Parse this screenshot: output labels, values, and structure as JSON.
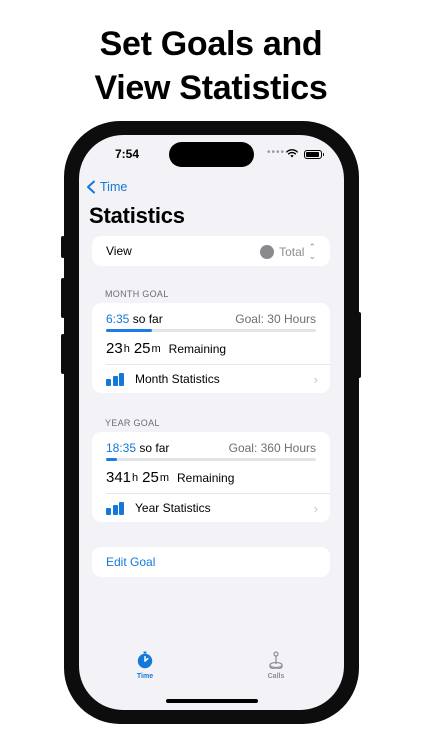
{
  "headline": {
    "line1": "Set Goals and",
    "line2": "View Statistics"
  },
  "status_bar": {
    "time": "7:54"
  },
  "nav": {
    "back_label": "Time",
    "title": "Statistics"
  },
  "view_row": {
    "label": "View",
    "value": "Total",
    "dot_color": "#8a8a8e"
  },
  "month_goal": {
    "section_label": "MONTH GOAL",
    "so_far_time": "6:35",
    "so_far_suffix": "so far",
    "goal_text": "Goal: 30 Hours",
    "progress_fraction": 0.22,
    "hours": "23",
    "hours_unit": "h",
    "minutes": "25",
    "minutes_unit": "m",
    "remaining_label": "Remaining",
    "stats_label": "Month Statistics"
  },
  "year_goal": {
    "section_label": "YEAR GOAL",
    "so_far_time": "18:35",
    "so_far_suffix": "so far",
    "goal_text": "Goal: 360 Hours",
    "progress_fraction": 0.05,
    "hours": "341",
    "hours_unit": "h",
    "minutes": "25",
    "minutes_unit": "m",
    "remaining_label": "Remaining",
    "stats_label": "Year Statistics"
  },
  "edit_goal_label": "Edit Goal",
  "tabs": [
    {
      "label": "Time",
      "icon": "stopwatch-icon",
      "selected": true
    },
    {
      "label": "Calls",
      "icon": "joystick-icon",
      "selected": false
    }
  ],
  "colors": {
    "accent": "#1478d9",
    "background": "#f2f2f7",
    "card": "#ffffff"
  }
}
